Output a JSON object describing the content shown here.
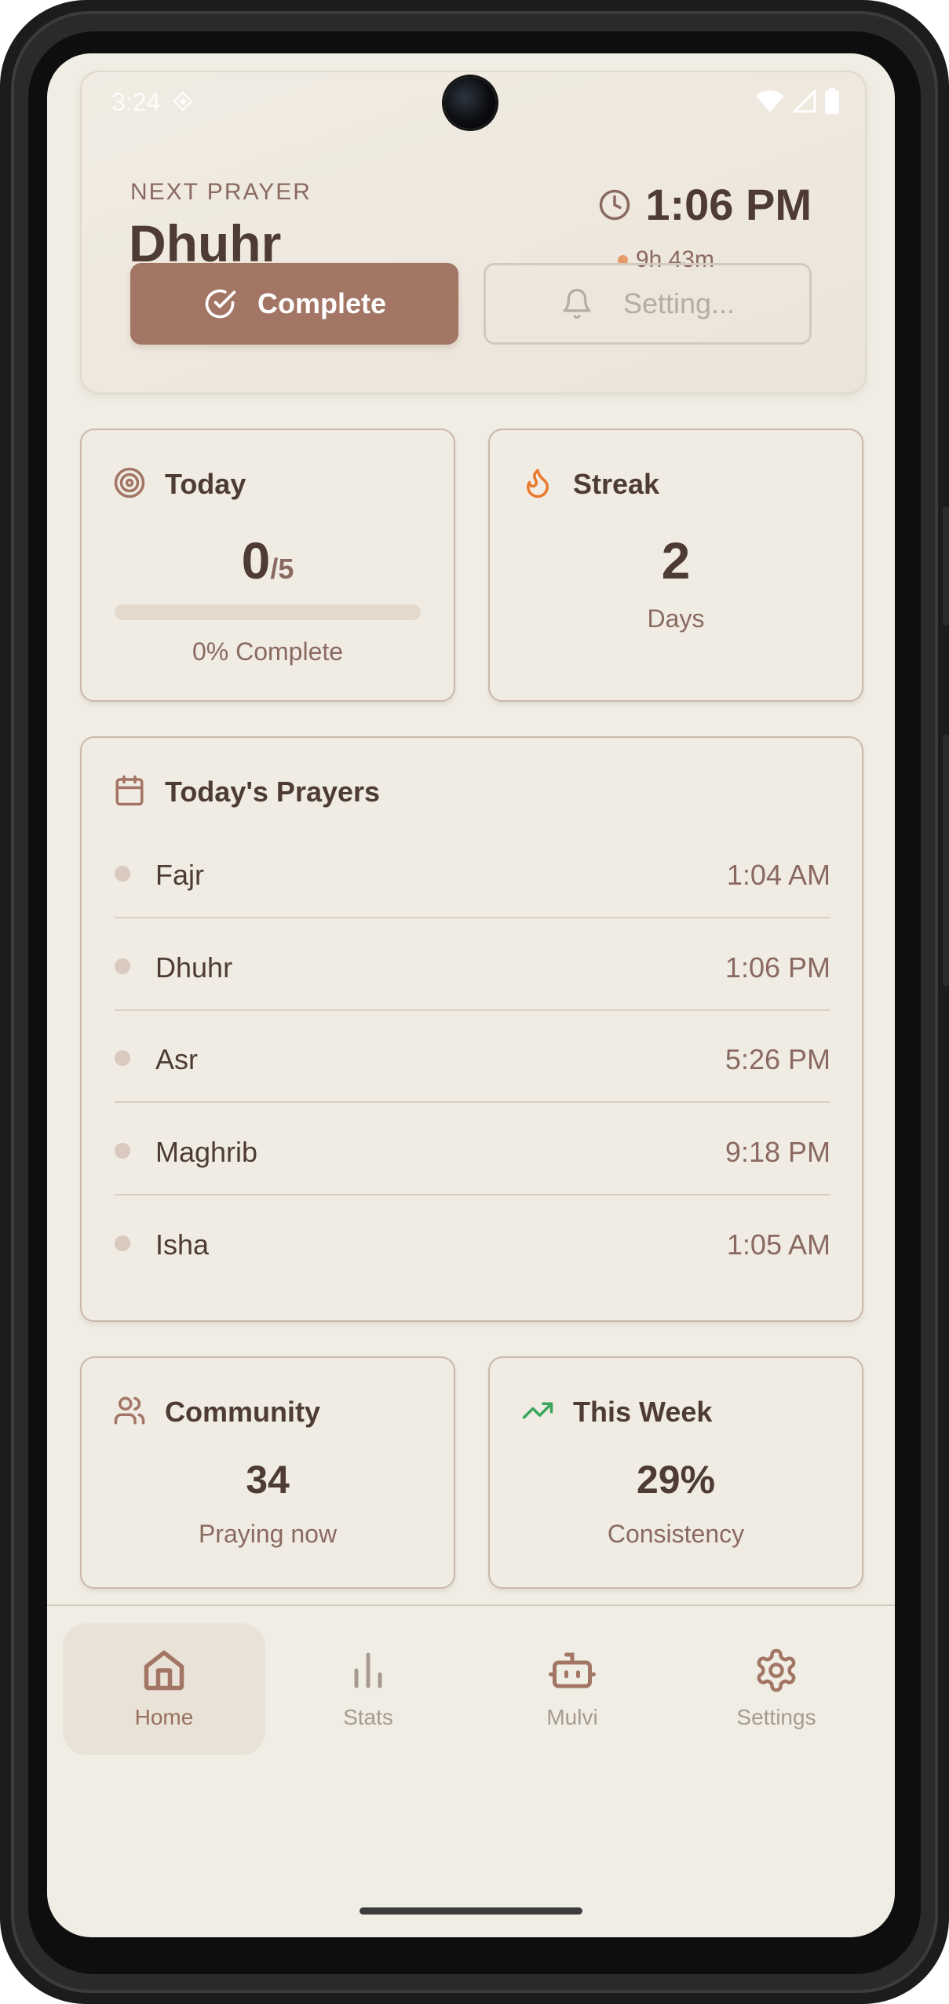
{
  "status_bar": {
    "time": "3:24"
  },
  "next_prayer": {
    "label": "NEXT PRAYER",
    "name": "Dhuhr",
    "time": "1:06 PM",
    "countdown": "9h 43m",
    "complete_label": "Complete",
    "setting_label": "Setting..."
  },
  "today": {
    "title": "Today",
    "count": "0",
    "total": "/5",
    "progress": 0,
    "complete_text": "0% Complete"
  },
  "streak": {
    "title": "Streak",
    "value": "2",
    "unit": "Days"
  },
  "prayers": {
    "title": "Today's Prayers",
    "items": [
      {
        "name": "Fajr",
        "time": "1:04 AM"
      },
      {
        "name": "Dhuhr",
        "time": "1:06 PM"
      },
      {
        "name": "Asr",
        "time": "5:26 PM"
      },
      {
        "name": "Maghrib",
        "time": "9:18 PM"
      },
      {
        "name": "Isha",
        "time": "1:05 AM"
      }
    ]
  },
  "community": {
    "title": "Community",
    "value": "34",
    "sub": "Praying now"
  },
  "this_week": {
    "title": "This Week",
    "value": "29%",
    "sub": "Consistency"
  },
  "nav": {
    "items": [
      {
        "label": "Home",
        "icon": "home-icon",
        "active": true
      },
      {
        "label": "Stats",
        "icon": "bar-chart-icon",
        "active": false
      },
      {
        "label": "Mulvi",
        "icon": "bot-icon",
        "active": false
      },
      {
        "label": "Settings",
        "icon": "gear-icon",
        "active": false
      }
    ]
  },
  "colors": {
    "background": "#f0ede4",
    "accent": "#a27565",
    "text_dark": "#4e3c34",
    "text_muted": "#8a6a60",
    "flame": "#e8792f",
    "trend": "#3aa65c"
  }
}
